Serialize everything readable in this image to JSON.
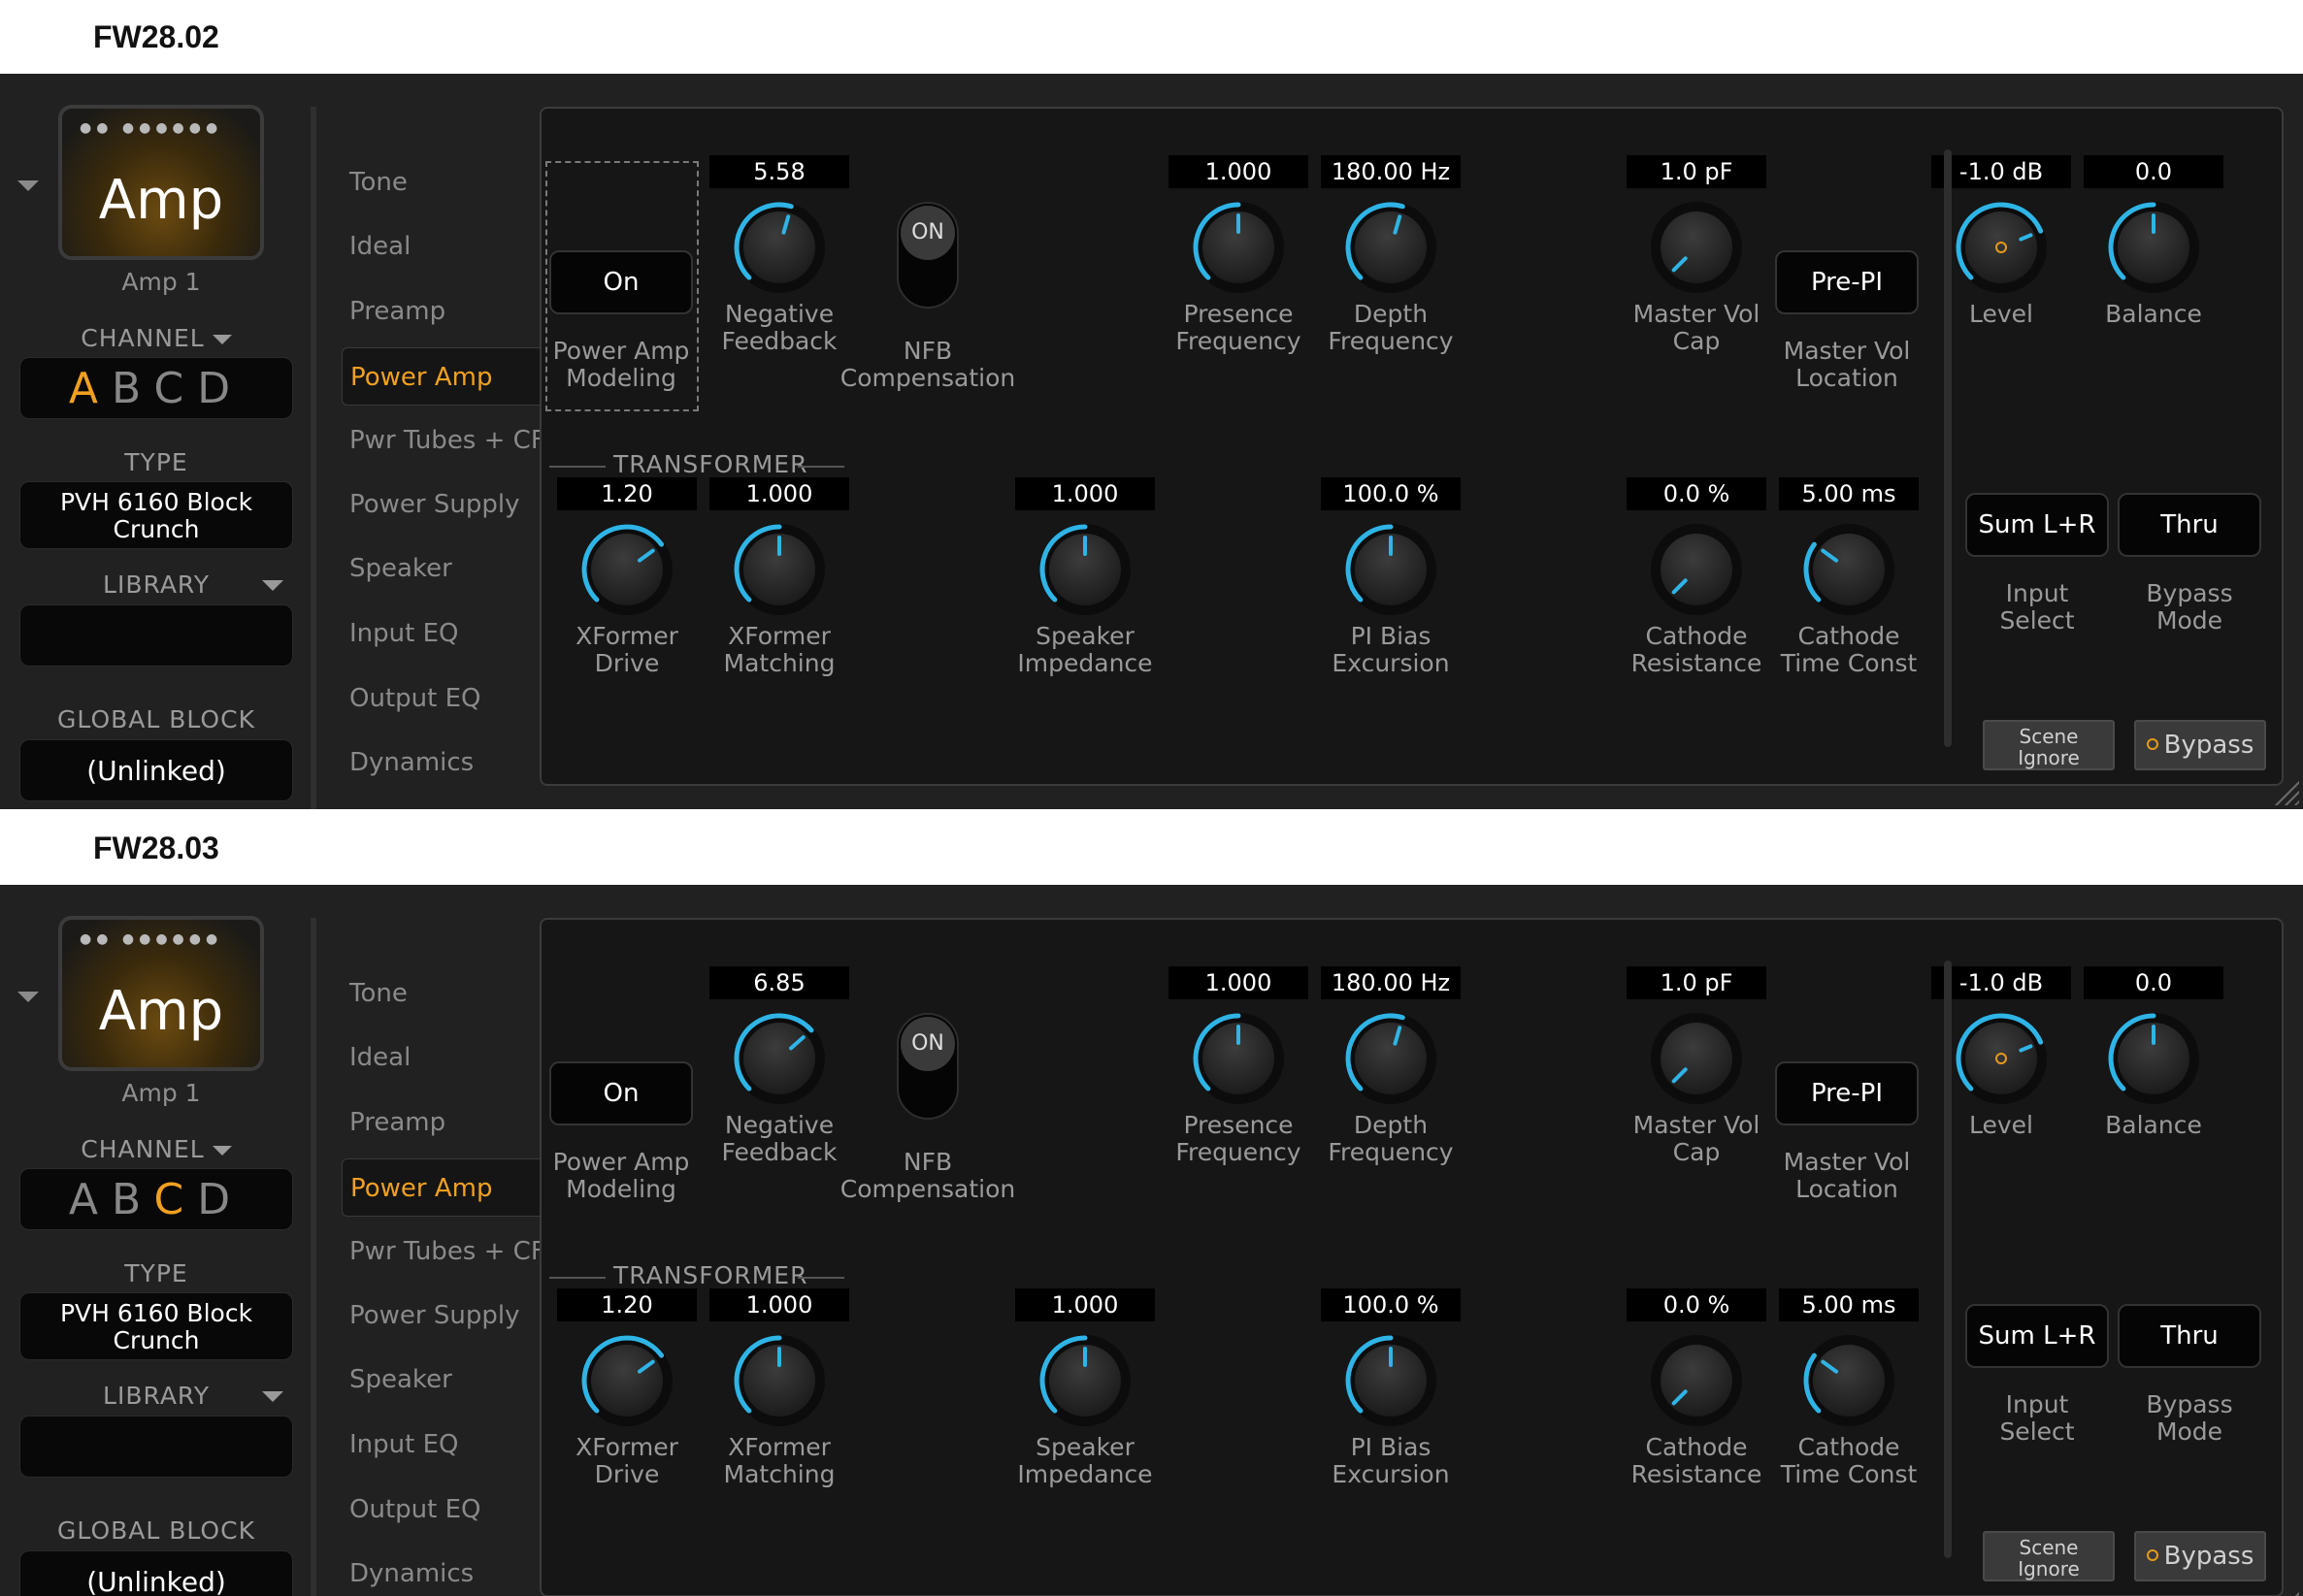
{
  "snapshots": [
    {
      "caption": "FW28.02",
      "amp": {
        "dots": "●● ●●●●●●",
        "title": "Amp",
        "subtitle": "Amp 1"
      },
      "channel": {
        "label": "CHANNEL",
        "options": [
          "A",
          "B",
          "C",
          "D"
        ],
        "active": "A"
      },
      "type": {
        "label": "TYPE",
        "value_line1": "PVH 6160 Block",
        "value_line2": "Crunch"
      },
      "library": {
        "label": "LIBRARY",
        "value": ""
      },
      "global_block": {
        "label": "GLOBAL BLOCK",
        "value": "(Unlinked)"
      },
      "menu": [
        "Tone",
        "Ideal",
        "Preamp",
        "Power Amp",
        "Pwr Tubes + CF",
        "Power Supply",
        "Speaker",
        "Input EQ",
        "Output EQ",
        "Dynamics"
      ],
      "menu_active": "Power Amp",
      "power_amp_modeling": {
        "button": "On",
        "label1": "Power Amp",
        "label2": "Modeling"
      },
      "negative_feedback": {
        "value": "5.58",
        "label1": "Negative",
        "label2": "Feedback",
        "level": 0.56
      },
      "nfb": {
        "toggle": "ON",
        "label1": "NFB",
        "label2": "Compensation"
      },
      "presence_frequency": {
        "value": "1.000",
        "label1": "Presence",
        "label2": "Frequency",
        "level": 0.5
      },
      "depth_frequency": {
        "value": "180.00 Hz",
        "label1": "Depth",
        "label2": "Frequency",
        "level": 0.56
      },
      "master_vol_cap": {
        "value": "1.0 pF",
        "label1": "Master Vol",
        "label2": "Cap",
        "level": 0.0
      },
      "master_vol_location": {
        "button": "Pre-PI",
        "label1": "Master Vol",
        "label2": "Location"
      },
      "level": {
        "value": "-1.0 dB",
        "label": "Level",
        "level": 0.75
      },
      "balance": {
        "value": "0.0",
        "label": "Balance",
        "level": 0.5
      },
      "transformer_title": "TRANSFORMER",
      "xformer_drive": {
        "value": "1.20",
        "label1": "XFormer",
        "label2": "Drive",
        "level": 0.7
      },
      "xformer_matching": {
        "value": "1.000",
        "label1": "XFormer",
        "label2": "Matching",
        "level": 0.5
      },
      "speaker_impedance": {
        "value": "1.000",
        "label1": "Speaker",
        "label2": "Impedance",
        "level": 0.5
      },
      "pi_bias_excursion": {
        "value": "100.0 %",
        "label1": "PI Bias",
        "label2": "Excursion",
        "level": 0.5
      },
      "cathode_resistance": {
        "value": "0.0 %",
        "label1": "Cathode",
        "label2": "Resistance",
        "level": 0.0
      },
      "cathode_time_const": {
        "value": "5.00 ms",
        "label1": "Cathode",
        "label2": "Time Const",
        "level": 0.3
      },
      "input_select": {
        "button": "Sum L+R",
        "label1": "Input",
        "label2": "Select"
      },
      "bypass_mode": {
        "button": "Thru",
        "label1": "Bypass",
        "label2": "Mode"
      },
      "scene_ignore": {
        "line1": "Scene",
        "line2": "Ignore"
      },
      "bypass_button": "Bypass"
    },
    {
      "caption": "FW28.03",
      "amp": {
        "dots": "●● ●●●●●●",
        "title": "Amp",
        "subtitle": "Amp 1"
      },
      "channel": {
        "label": "CHANNEL",
        "options": [
          "A",
          "B",
          "C",
          "D"
        ],
        "active": "C"
      },
      "type": {
        "label": "TYPE",
        "value_line1": "PVH 6160 Block",
        "value_line2": "Crunch"
      },
      "library": {
        "label": "LIBRARY",
        "value": ""
      },
      "global_block": {
        "label": "GLOBAL BLOCK",
        "value": "(Unlinked)"
      },
      "menu": [
        "Tone",
        "Ideal",
        "Preamp",
        "Power Amp",
        "Pwr Tubes + CF",
        "Power Supply",
        "Speaker",
        "Input EQ",
        "Output EQ",
        "Dynamics"
      ],
      "menu_active": "Power Amp",
      "power_amp_modeling": {
        "button": "On",
        "label1": "Power Amp",
        "label2": "Modeling"
      },
      "negative_feedback": {
        "value": "6.85",
        "label1": "Negative",
        "label2": "Feedback",
        "level": 0.68
      },
      "nfb": {
        "toggle": "ON",
        "label1": "NFB",
        "label2": "Compensation"
      },
      "presence_frequency": {
        "value": "1.000",
        "label1": "Presence",
        "label2": "Frequency",
        "level": 0.5
      },
      "depth_frequency": {
        "value": "180.00 Hz",
        "label1": "Depth",
        "label2": "Frequency",
        "level": 0.56
      },
      "master_vol_cap": {
        "value": "1.0 pF",
        "label1": "Master Vol",
        "label2": "Cap",
        "level": 0.0
      },
      "master_vol_location": {
        "button": "Pre-PI",
        "label1": "Master Vol",
        "label2": "Location"
      },
      "level": {
        "value": "-1.0 dB",
        "label": "Level",
        "level": 0.75
      },
      "balance": {
        "value": "0.0",
        "label": "Balance",
        "level": 0.5
      },
      "transformer_title": "TRANSFORMER",
      "xformer_drive": {
        "value": "1.20",
        "label1": "XFormer",
        "label2": "Drive",
        "level": 0.7
      },
      "xformer_matching": {
        "value": "1.000",
        "label1": "XFormer",
        "label2": "Matching",
        "level": 0.5
      },
      "speaker_impedance": {
        "value": "1.000",
        "label1": "Speaker",
        "label2": "Impedance",
        "level": 0.5
      },
      "pi_bias_excursion": {
        "value": "100.0 %",
        "label1": "PI Bias",
        "label2": "Excursion",
        "level": 0.5
      },
      "cathode_resistance": {
        "value": "0.0 %",
        "label1": "Cathode",
        "label2": "Resistance",
        "level": 0.0
      },
      "cathode_time_const": {
        "value": "5.00 ms",
        "label1": "Cathode",
        "label2": "Time Const",
        "level": 0.3
      },
      "input_select": {
        "button": "Sum L+R",
        "label1": "Input",
        "label2": "Select"
      },
      "bypass_mode": {
        "button": "Thru",
        "label1": "Bypass",
        "label2": "Mode"
      },
      "scene_ignore": {
        "line1": "Scene",
        "line2": "Ignore"
      },
      "bypass_button": "Bypass"
    }
  ],
  "colors": {
    "accent_knob": "#2fb4e6",
    "active_text": "#f0a020",
    "bypass_ring": "#e49b1a"
  },
  "icons": {
    "collapse": "triangle-down-icon",
    "dropdown": "chevron-down-icon"
  }
}
